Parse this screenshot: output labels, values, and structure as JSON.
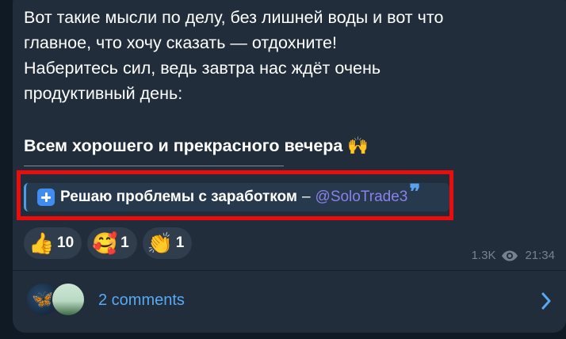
{
  "message": {
    "paragraph": "Вот такие мысли по делу, без лишней воды и вот что\nглавное, что хочу сказать — отдохните!\nНаберитесь сил, ведь завтра нас ждёт очень\nпродуктивный день:",
    "bold_line": "Всем хорошего и прекрасного вечера",
    "bold_emoji": "🙌"
  },
  "quote": {
    "icon": "plus-icon",
    "text": "Решаю проблемы с заработком",
    "dash": "–",
    "link": "@SoloTrade3",
    "mark": "❞"
  },
  "reactions": [
    {
      "emoji": "👍",
      "count": "10"
    },
    {
      "emoji": "🥰",
      "count": "1"
    },
    {
      "emoji": "👏",
      "count": "1"
    }
  ],
  "meta": {
    "views": "1.3K",
    "time": "21:34"
  },
  "comments": {
    "label": "2 comments",
    "avatar1_emoji": "🦋"
  },
  "colors": {
    "bubble": "#212d3b",
    "highlight": "#ec0c0c",
    "link": "#8c80ea",
    "accent": "#58a9f3"
  }
}
